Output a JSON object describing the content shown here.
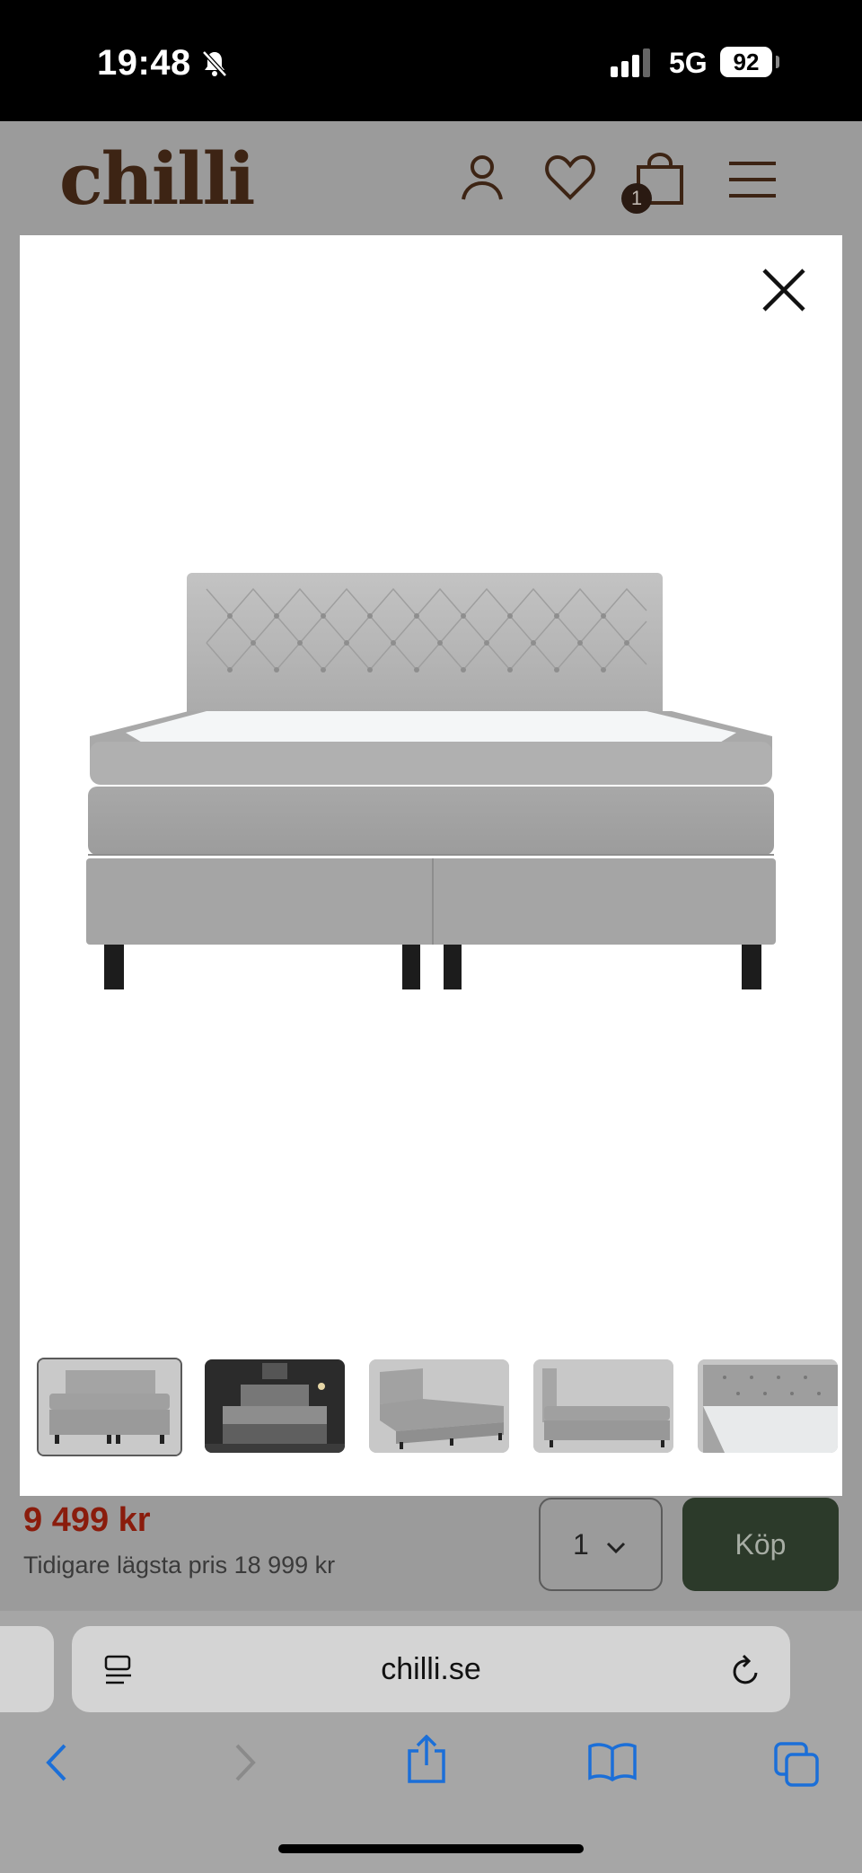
{
  "status_bar": {
    "time": "19:48",
    "network": "5G",
    "battery": "92"
  },
  "site_header": {
    "logo": "chilli",
    "cart_count": "1"
  },
  "modal": {
    "thumbnails": [
      {
        "name": "bed-front-view"
      },
      {
        "name": "bed-room-dark"
      },
      {
        "name": "bed-angle-view"
      },
      {
        "name": "bed-side-view"
      },
      {
        "name": "headboard-detail"
      }
    ]
  },
  "purchase": {
    "price": "9 499 kr",
    "previous_price": "Tidigare lägsta pris 18 999 kr",
    "quantity": "1",
    "buy_label": "Köp"
  },
  "browser": {
    "url": "chilli.se"
  },
  "colors": {
    "accent_green": "#2c3a2a",
    "price_red": "#8a1c0c",
    "logo_brown": "#3d2414"
  }
}
